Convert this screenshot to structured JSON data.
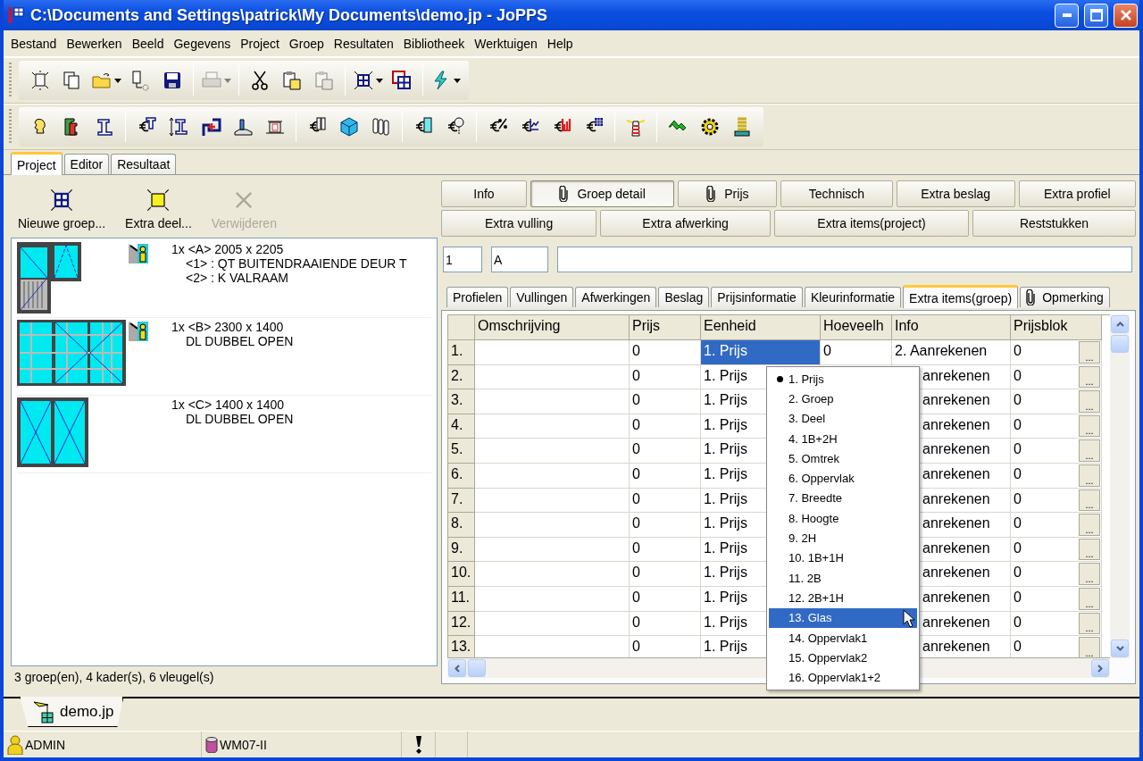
{
  "window": {
    "title": "C:\\Documents and Settings\\patrick\\My Documents\\demo.jp - JoPPS"
  },
  "menu": [
    "Bestand",
    "Bewerken",
    "Beeld",
    "Gegevens",
    "Project",
    "Groep",
    "Resultaten",
    "Bibliotheek",
    "Werktuigen",
    "Help"
  ],
  "toolbar_1": [
    [
      {
        "kind": "new",
        "disabled": false,
        "dropdown": false
      },
      {
        "kind": "copy",
        "disabled": false,
        "dropdown": false
      },
      {
        "kind": "open",
        "disabled": false,
        "dropdown": true
      },
      {
        "kind": "import",
        "disabled": false,
        "dropdown": false
      },
      {
        "kind": "save",
        "disabled": false,
        "dropdown": false
      }
    ],
    [
      {
        "kind": "print",
        "disabled": true,
        "dropdown": true
      }
    ],
    [
      {
        "kind": "cut",
        "disabled": false,
        "dropdown": false
      },
      {
        "kind": "paste",
        "disabled": false,
        "dropdown": false
      },
      {
        "kind": "paste",
        "disabled": true,
        "dropdown": false
      }
    ],
    [
      {
        "kind": "grid",
        "disabled": false,
        "dropdown": true
      },
      {
        "kind": "windows",
        "disabled": false,
        "dropdown": false
      }
    ],
    [
      {
        "kind": "lightning",
        "disabled": false,
        "dropdown": true
      }
    ]
  ],
  "toolbar_2": [
    [
      {
        "kind": "head"
      },
      {
        "kind": "profiles"
      },
      {
        "kind": "profile"
      }
    ],
    [
      {
        "kind": "euro_profile"
      },
      {
        "kind": "profile_height"
      },
      {
        "kind": "corner_plus"
      },
      {
        "kind": "sill"
      },
      {
        "kind": "frame"
      }
    ],
    [
      {
        "kind": "euro_hinge"
      },
      {
        "kind": "cube"
      },
      {
        "kind": "hinges"
      }
    ],
    [
      {
        "kind": "euro_glass"
      },
      {
        "kind": "euro_roll"
      }
    ],
    [
      {
        "kind": "euro_percent"
      },
      {
        "kind": "euro_line"
      },
      {
        "kind": "euro_bars"
      },
      {
        "kind": "euro_table"
      }
    ],
    [
      {
        "kind": "lighthouse"
      }
    ],
    [
      {
        "kind": "arrows"
      },
      {
        "kind": "gear"
      },
      {
        "kind": "spring"
      }
    ]
  ],
  "left_tabs": [
    {
      "label": "Project",
      "selected": true
    },
    {
      "label": "Editor",
      "selected": false
    },
    {
      "label": "Resultaat",
      "selected": false
    }
  ],
  "group_actions": [
    {
      "label": "Nieuwe groep...",
      "kind": "new_group",
      "disabled": false
    },
    {
      "label": "Extra deel...",
      "kind": "extra_part",
      "disabled": false
    },
    {
      "label": "Verwijderen",
      "kind": "delete",
      "disabled": true
    }
  ],
  "groups": [
    {
      "kind": "door_and_window",
      "marked": true,
      "title": "1x <A> 2005 x 2205",
      "details": [
        "<1> : QT BUITENDRAAIENDE DEUR T",
        "<2> : K VALRAAM"
      ]
    },
    {
      "kind": "triple_window",
      "marked": true,
      "title": "1x <B> 2300 x 1400",
      "details": [
        "DL DUBBEL OPEN"
      ]
    },
    {
      "kind": "double_window",
      "marked": false,
      "title": "1x <C> 1400 x 1400",
      "details": [
        "DL DUBBEL OPEN"
      ]
    }
  ],
  "list_status": "3 groep(en), 4 kader(s), 6 vleugel(s)",
  "detail_buttons": [
    [
      {
        "label": "Info",
        "selected": false,
        "attachment": false
      },
      {
        "label": "Groep detail",
        "selected": true,
        "attachment": true
      },
      {
        "label": "Prijs",
        "selected": false,
        "attachment": true
      },
      {
        "label": "Technisch",
        "selected": false,
        "attachment": false
      },
      {
        "label": "Extra beslag",
        "selected": false,
        "attachment": false
      },
      {
        "label": "Extra profiel",
        "selected": false,
        "attachment": false
      }
    ],
    [
      {
        "label": "Extra vulling",
        "selected": false,
        "attachment": false
      },
      {
        "label": "Extra afwerking",
        "selected": false,
        "attachment": false
      },
      {
        "label": "Extra items(project)",
        "selected": false,
        "attachment": false
      },
      {
        "label": "Reststukken",
        "selected": false,
        "attachment": false
      }
    ]
  ],
  "header_fields": [
    {
      "kind": "number",
      "value": "1"
    },
    {
      "kind": "code",
      "value": "A"
    },
    {
      "kind": "description"
    }
  ],
  "sub_tabs": [
    {
      "label": "Profielen",
      "selected": false,
      "attachment": false
    },
    {
      "label": "Vullingen",
      "selected": false,
      "attachment": false
    },
    {
      "label": "Afwerkingen",
      "selected": false,
      "attachment": false
    },
    {
      "label": "Beslag",
      "selected": false,
      "attachment": false
    },
    {
      "label": "Prijsinformatie",
      "selected": false,
      "attachment": false
    },
    {
      "label": "Kleurinformatie",
      "selected": false,
      "attachment": false
    },
    {
      "label": "Extra items(groep)",
      "selected": true,
      "attachment": false
    },
    {
      "label": "Opmerking",
      "selected": false,
      "attachment": true
    }
  ],
  "table": {
    "columns": [
      "Omschrijving",
      "Prijs",
      "Eenheid",
      "Hoeveelh",
      "Info",
      "Prijsblok"
    ],
    "rows": [
      {
        "index": "1.",
        "prijs": "0",
        "eenheid": "1. Prijs",
        "hoeveelheid": "0",
        "info": "2. Aanrekenen",
        "prijsblok": "0",
        "button": "...",
        "selected": true
      },
      {
        "index": "2.",
        "prijs": "0",
        "eenheid": "1. Prijs",
        "info": "anrekenen",
        "prijsblok": "0",
        "button": "...",
        "selected": false
      },
      {
        "index": "3.",
        "prijs": "0",
        "eenheid": "1. Prijs",
        "info": "anrekenen",
        "prijsblok": "0",
        "button": "...",
        "selected": false
      },
      {
        "index": "4.",
        "prijs": "0",
        "eenheid": "1. Prijs",
        "info": "anrekenen",
        "prijsblok": "0",
        "button": "...",
        "selected": false
      },
      {
        "index": "5.",
        "prijs": "0",
        "eenheid": "1. Prijs",
        "info": "anrekenen",
        "prijsblok": "0",
        "button": "...",
        "selected": false
      },
      {
        "index": "6.",
        "prijs": "0",
        "eenheid": "1. Prijs",
        "info": "anrekenen",
        "prijsblok": "0",
        "button": "...",
        "selected": false
      },
      {
        "index": "7.",
        "prijs": "0",
        "eenheid": "1. Prijs",
        "info": "anrekenen",
        "prijsblok": "0",
        "button": "...",
        "selected": false
      },
      {
        "index": "8.",
        "prijs": "0",
        "eenheid": "1. Prijs",
        "info": "anrekenen",
        "prijsblok": "0",
        "button": "...",
        "selected": false
      },
      {
        "index": "9.",
        "prijs": "0",
        "eenheid": "1. Prijs",
        "info": "anrekenen",
        "prijsblok": "0",
        "button": "...",
        "selected": false
      },
      {
        "index": "10.",
        "prijs": "0",
        "eenheid": "1. Prijs",
        "info": "anrekenen",
        "prijsblok": "0",
        "button": "...",
        "selected": false
      },
      {
        "index": "11.",
        "prijs": "0",
        "eenheid": "1. Prijs",
        "info": "anrekenen",
        "prijsblok": "0",
        "button": "...",
        "selected": false
      },
      {
        "index": "12.",
        "prijs": "0",
        "eenheid": "1. Prijs",
        "info": "anrekenen",
        "prijsblok": "0",
        "button": "...",
        "selected": false
      },
      {
        "index": "13.",
        "prijs": "0",
        "eenheid": "1. Prijs",
        "info": "anrekenen",
        "prijsblok": "0",
        "button": "...",
        "selected": false
      }
    ]
  },
  "unit_dropdown": {
    "options": [
      {
        "label": "1. Prijs",
        "checked": true,
        "selected": false
      },
      {
        "label": "2. Groep",
        "checked": false,
        "selected": false
      },
      {
        "label": "3. Deel",
        "checked": false,
        "selected": false
      },
      {
        "label": "4. 1B+2H",
        "checked": false,
        "selected": false
      },
      {
        "label": "5. Omtrek",
        "checked": false,
        "selected": false
      },
      {
        "label": "6. Oppervlak",
        "checked": false,
        "selected": false
      },
      {
        "label": "7. Breedte",
        "checked": false,
        "selected": false
      },
      {
        "label": "8. Hoogte",
        "checked": false,
        "selected": false
      },
      {
        "label": "9. 2H",
        "checked": false,
        "selected": false
      },
      {
        "label": "10. 1B+1H",
        "checked": false,
        "selected": false
      },
      {
        "label": "11. 2B",
        "checked": false,
        "selected": false
      },
      {
        "label": "12. 2B+1H",
        "checked": false,
        "selected": false
      },
      {
        "label": "13. Glas",
        "checked": false,
        "selected": true
      },
      {
        "label": "14. Oppervlak1",
        "checked": false,
        "selected": false
      },
      {
        "label": "15. Oppervlak2",
        "checked": false,
        "selected": false
      },
      {
        "label": "16. Oppervlak1+2",
        "checked": false,
        "selected": false
      }
    ]
  },
  "doc_tabs": [
    {
      "label": "demo.jp",
      "selected": true
    }
  ],
  "status_bar": [
    {
      "kind": "user",
      "text": "ADMIN"
    },
    {
      "kind": "database",
      "text": "WM07-II"
    },
    {
      "kind": "alert"
    },
    {
      "kind": "empty"
    }
  ]
}
